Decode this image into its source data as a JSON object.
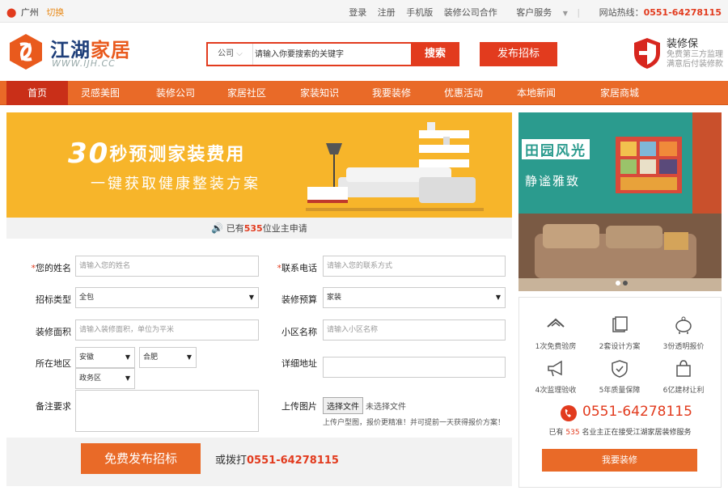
{
  "topbar": {
    "city": "广州",
    "switch": "切换",
    "links": [
      "登录",
      "注册",
      "手机版",
      "装修公司合作",
      "客户服务"
    ],
    "hotline_label": "网站热线：",
    "hotline": "0551-64278115"
  },
  "logo": {
    "name_a": "江湖",
    "name_b": "家居",
    "url": "WWW.IJH.CC"
  },
  "search": {
    "scope": "公司",
    "placeholder": "请输入你要搜索的关键字",
    "button": "搜索"
  },
  "publish_button": "发布招标",
  "guarantee": {
    "title": "装修保",
    "line1": "免费第三方监理",
    "line2": "满意后付装修款"
  },
  "nav": [
    "首页",
    "灵感美图",
    "装修公司",
    "家居社区",
    "家装知识",
    "我要装修",
    "优惠活动",
    "本地新闻",
    "家居商城"
  ],
  "banner": {
    "number": "30",
    "title": "秒预测家装费用",
    "subtitle": "一键获取健康整装方案"
  },
  "apply": {
    "prefix": "已有",
    "count": "535",
    "suffix": "位业主申请"
  },
  "form": {
    "name_label": "您的姓名",
    "name_placeholder": "请输入您的姓名",
    "phone_label": "联系电话",
    "phone_placeholder": "请输入您的联系方式",
    "type_label": "招标类型",
    "type_value": "全包",
    "budget_label": "装修预算",
    "budget_value": "家装",
    "area_label": "装修面积",
    "area_placeholder": "请输入装修面积，单位为平米",
    "community_label": "小区名称",
    "community_placeholder": "请输入小区名称",
    "region_label": "所在地区",
    "province": "安徽",
    "city": "合肥",
    "district": "政务区",
    "address_label": "详细地址",
    "remark_label": "备注要求",
    "upload_label": "上传图片",
    "upload_button": "选择文件",
    "upload_status": "未选择文件",
    "upload_hint": "上传户型图，报价更精准！并可提前一天获得报价方案！"
  },
  "submit": {
    "button": "免费发布招标",
    "call_prefix": "或拨打",
    "call_number": "0551-64278115"
  },
  "photo": {
    "title": "田园风光",
    "subtitle": "静谧雅致"
  },
  "services": [
    {
      "label": "1次免费验房",
      "icon": "house-icon"
    },
    {
      "label": "2套设计方案",
      "icon": "document-icon"
    },
    {
      "label": "3份透明报价",
      "icon": "piggy-bank-icon"
    },
    {
      "label": "4次监理验收",
      "icon": "megaphone-icon"
    },
    {
      "label": "5年质量保障",
      "icon": "shield-icon"
    },
    {
      "label": "6亿建材让利",
      "icon": "bag-icon"
    }
  ],
  "service_phone": "0551-64278115",
  "service_note": {
    "prefix": "已有",
    "count": "535",
    "suffix": "名业主正在接受江湖家居装修服务"
  },
  "service_button": "我要装修",
  "colors": {
    "brand_red": "#e23b1e",
    "nav_orange": "#e96a28",
    "banner_yellow": "#f7b52a",
    "teal": "#2b9b8e"
  }
}
